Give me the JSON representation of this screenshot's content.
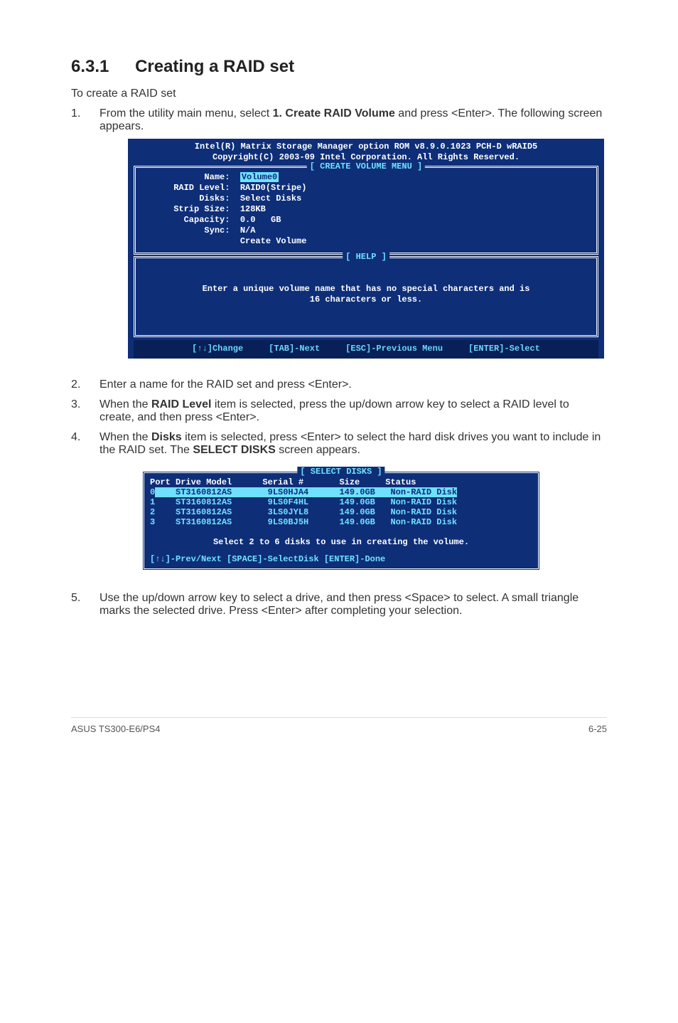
{
  "page": {
    "heading_number": "6.3.1",
    "heading_title": "Creating a RAID set",
    "intro": "To create a RAID set",
    "footer_left": "ASUS TS300-E6/PS4",
    "footer_right": "6-25"
  },
  "steps": {
    "s1_prefix": "From the utility main menu, select ",
    "s1_bold": "1. Create RAID Volume",
    "s1_suffix": " and press <Enter>. The following screen appears.",
    "s2": "Enter a name for the RAID set and press <Enter>.",
    "s3_prefix": "When the ",
    "s3_bold": "RAID Level",
    "s3_suffix": " item is selected, press the up/down arrow key to select a RAID level to create, and then press <Enter>.",
    "s4_prefix": "When the ",
    "s4_bold1": "Disks",
    "s4_mid": " item is selected, press <Enter> to select the hard disk drives you want to include in the RAID set. The ",
    "s4_bold2": "SELECT DISKS",
    "s4_suffix": " screen appears.",
    "s5": "Use the up/down arrow key to select a drive, and then press <Space> to select. A small triangle marks the selected drive. Press <Enter> after completing your selection."
  },
  "bios": {
    "title1": "Intel(R) Matrix Storage Manager option ROM v8.9.0.1023 PCH-D wRAID5",
    "title2": "Copyright(C) 2003-09 Intel Corporation.  All Rights Reserved.",
    "menu_label": "[ CREATE VOLUME MENU ]",
    "fields": {
      "name_label": "            Name:  ",
      "name_value": "Volume0",
      "raid_level": "      RAID Level:  RAID0(Stripe)",
      "disks": "           Disks:  Select Disks",
      "strip": "      Strip Size:  128KB",
      "capacity": "        Capacity:  0.0   GB",
      "sync": "            Sync:  N/A",
      "create": "                   Create Volume"
    },
    "help_label": "[ HELP ]",
    "help_text1": "Enter a unique volume name that has no special characters and is",
    "help_text2": "16 characters or less.",
    "footer": "[↑↓]Change     [TAB]-Next     [ESC]-Previous Menu     [ENTER]-Select"
  },
  "disks_panel": {
    "legend": "[ SELECT DISKS ]",
    "header": "Port Drive Model      Serial #       Size     Status",
    "rows": [
      {
        "port": "0",
        "line": "    ST3160812AS       9LS0HJA4      149.0GB   Non-RAID Disk",
        "selected": true
      },
      {
        "port": "1",
        "line": "    ST3160812AS       9LS0F4HL      149.0GB   Non-RAID Disk",
        "selected": false
      },
      {
        "port": "2",
        "line": "    ST3160812AS       3LS0JYL8      149.0GB   Non-RAID Disk",
        "selected": false
      },
      {
        "port": "3",
        "line": "    ST3160812AS       9LS0BJ5H      149.0GB   Non-RAID Disk",
        "selected": false
      }
    ],
    "msg": "Select 2 to 6 disks to use in creating the volume.",
    "nav": "[↑↓]-Prev/Next [SPACE]-SelectDisk [ENTER]-Done"
  }
}
